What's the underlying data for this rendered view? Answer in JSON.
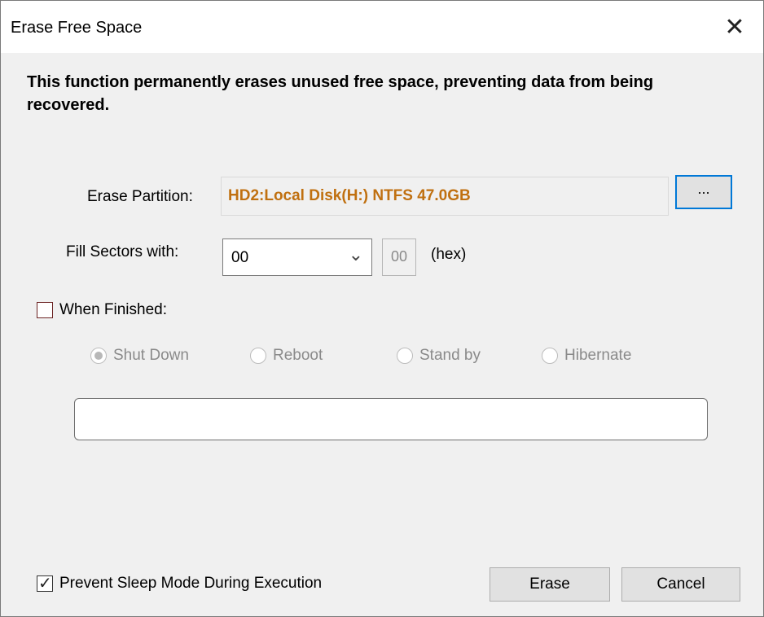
{
  "window": {
    "title": "Erase Free Space"
  },
  "description": "This function permanently erases unused free space, preventing data from being recovered.",
  "partition": {
    "label": "Erase Partition:",
    "value": "HD2:Local Disk(H:) NTFS 47.0GB",
    "browse_label": "...",
    "value_color": "#c07010"
  },
  "fill": {
    "label": "Fill Sectors with:",
    "selected": "00",
    "hex_value": "00",
    "hex_unit": "(hex)"
  },
  "when_finished": {
    "label": "When Finished:",
    "checked": false,
    "options": [
      {
        "label": "Shut Down",
        "selected": true
      },
      {
        "label": "Reboot",
        "selected": false
      },
      {
        "label": "Stand by",
        "selected": false
      },
      {
        "label": "Hibernate",
        "selected": false
      }
    ]
  },
  "progress": {
    "value": ""
  },
  "prevent_sleep": {
    "label": "Prevent Sleep Mode During Execution",
    "checked": true
  },
  "buttons": {
    "erase": "Erase",
    "cancel": "Cancel"
  }
}
